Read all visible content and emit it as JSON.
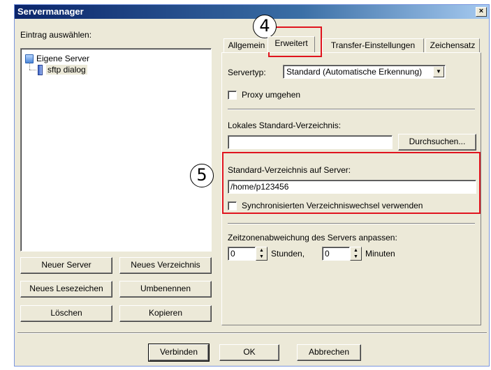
{
  "window": {
    "title": "Servermanager",
    "close": "×"
  },
  "left": {
    "select_label": "Eintrag auswählen:",
    "tree": [
      {
        "label": "Eigene Server"
      },
      {
        "label": "sftp dialog"
      }
    ],
    "buttons": {
      "new_server": "Neuer Server",
      "new_folder": "Neues Verzeichnis",
      "new_bookmark": "Neues Lesezeichen",
      "rename": "Umbenennen",
      "delete": "Löschen",
      "copy": "Kopieren"
    }
  },
  "tabs": [
    "Allgemein",
    "Erweitert",
    "Transfer-Einstellungen",
    "Zeichensatz"
  ],
  "active_tab": "Erweitert",
  "advanced": {
    "servertype_label": "Servertyp:",
    "servertype_value": "Standard (Automatische Erkennung)",
    "bypass_proxy_label": "Proxy umgehen",
    "local_dir_label": "Lokales Standard-Verzeichnis:",
    "local_dir_value": "",
    "browse_label": "Durchsuchen...",
    "remote_dir_label": "Standard-Verzeichnis auf Server:",
    "remote_dir_value": "/home/p123456",
    "sync_browse_label": "Synchronisierten Verzeichniswechsel verwenden",
    "timezone_label": "Zeitzonenabweichung des Servers anpassen:",
    "hours_value": "0",
    "hours_label": "Stunden,",
    "minutes_value": "0",
    "minutes_label": "Minuten"
  },
  "footer": {
    "connect": "Verbinden",
    "ok": "OK",
    "cancel": "Abbrechen"
  },
  "annotations": {
    "callout_4": "4",
    "callout_5": "5",
    "highlight_color": "#e0141e"
  }
}
